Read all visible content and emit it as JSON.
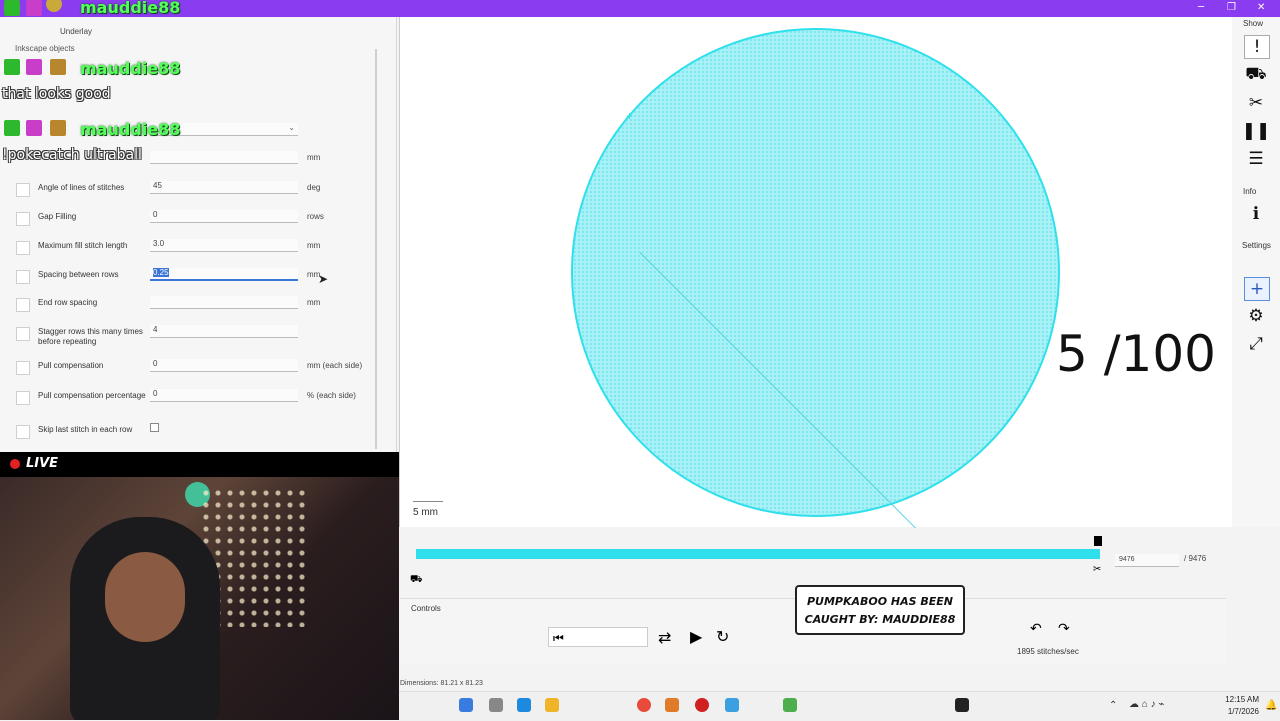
{
  "window": {
    "minimize": "─",
    "maximize": "❐",
    "close": "✕"
  },
  "left_panel": {
    "tab_underlay": "Underlay",
    "inkscape_objects": "Inkscape objects",
    "rows": [
      {
        "label": "Angle of lines of stitches",
        "value": "45",
        "unit": "deg"
      },
      {
        "label": "Gap Filling",
        "value": "0",
        "unit": "rows"
      },
      {
        "label": "Maximum fill stitch length",
        "value": "3.0",
        "unit": "mm"
      },
      {
        "label": "Spacing between rows",
        "value": "0.25",
        "unit": "mm"
      },
      {
        "label": "End row spacing",
        "value": "",
        "unit": "mm"
      },
      {
        "label": "Stagger rows this many times before repeating",
        "value": "4",
        "unit": ""
      },
      {
        "label": "Pull compensation",
        "value": "0",
        "unit": "mm (each side)"
      },
      {
        "label": "Pull compensation percentage",
        "value": "0",
        "unit": "% (each side)"
      },
      {
        "label": "Skip last stitch in each row",
        "value": "",
        "unit": ""
      }
    ],
    "top_unit": "mm"
  },
  "chat": {
    "username": "mauddie88",
    "messages": [
      "that looks good",
      "!pokecatch ultraball"
    ]
  },
  "live_label": "LIVE",
  "canvas": {
    "overlay_counter": "5 /100",
    "scale_label": "5 mm"
  },
  "right_toolbar": {
    "show_label": "Show",
    "info_label": "Info",
    "settings_label": "Settings"
  },
  "progress": {
    "current_value": "9476",
    "total": "/ 9476",
    "fraction": 1.0
  },
  "controls": {
    "label": "Controls",
    "speed": "1895 stitches/sec",
    "dimensions": "Dimensions: 81.21 x 81.23"
  },
  "alert": {
    "line1": "PUMPKABOO HAS BEEN",
    "line2": "CAUGHT BY: MAUDDIE88"
  },
  "clock": {
    "time": "12:15 AM",
    "date": "1/7/2026"
  },
  "colors": {
    "fill": "#a9f2f6",
    "accent": "#2fe0ec",
    "chat_name": "#54ff5a",
    "title_bar": "#8a3df0"
  }
}
